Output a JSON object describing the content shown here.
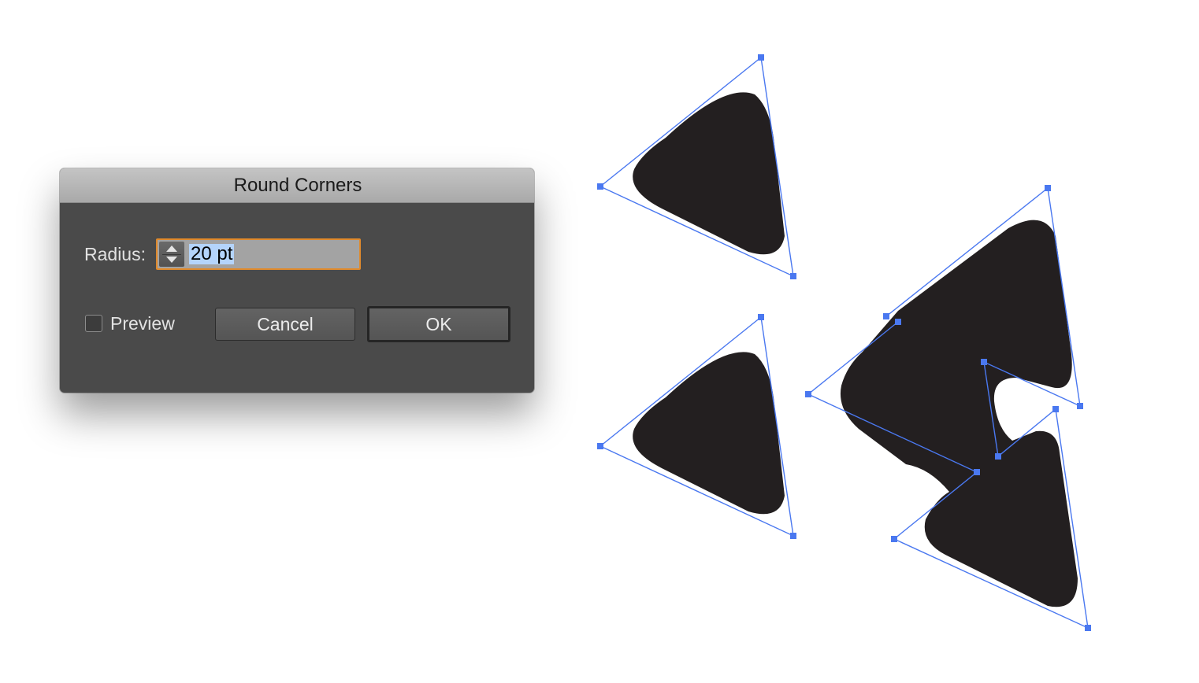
{
  "dialog": {
    "title": "Round Corners",
    "radius_label": "Radius:",
    "radius_value": "20 pt",
    "radius_value_selected": true,
    "preview_label": "Preview",
    "preview_checked": false,
    "cancel_label": "Cancel",
    "ok_label": "OK",
    "stepper_up_icon": "chevron-up-icon",
    "stepper_down_icon": "chevron-down-icon"
  },
  "canvas": {
    "shape_count": 4,
    "shape_fill": "#231f20",
    "selection_color": "#4a78f0"
  },
  "colors": {
    "dialog_bg": "#4a4a4a",
    "titlebar": "#b5b5b5",
    "focus_ring": "#e08a2c",
    "text_selection": "#b4d4fb"
  }
}
